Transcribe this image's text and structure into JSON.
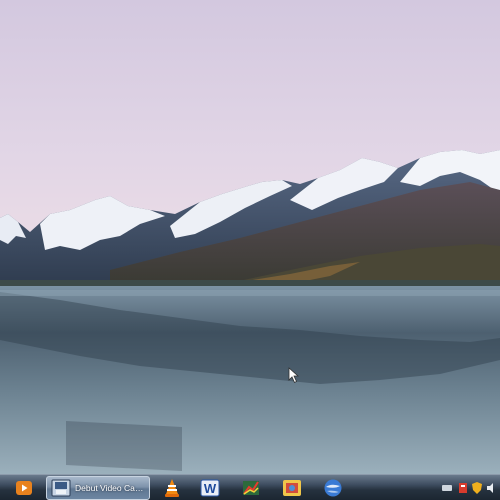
{
  "desktop": {
    "wallpaper": "lake-mountains-wallpaper"
  },
  "taskbar": {
    "start_icon": "media-player-icon",
    "active_task": {
      "icon": "video-capture-icon",
      "label": "Debut Video Capt..."
    },
    "pinned": [
      {
        "name": "vlc-icon"
      },
      {
        "name": "word-icon"
      },
      {
        "name": "graph-app-icon"
      },
      {
        "name": "photo-app-icon"
      },
      {
        "name": "google-earth-icon"
      }
    ],
    "tray": [
      {
        "name": "keyboard-tray-icon"
      },
      {
        "name": "security-tray-icon"
      },
      {
        "name": "shield-tray-icon"
      },
      {
        "name": "volume-tray-icon"
      }
    ]
  },
  "colors": {
    "sky_top": "#d7cde2",
    "sky_bottom": "#eadce8",
    "water": "#5f7382",
    "taskbar": "#2a3644",
    "active_task": "#7e93ab"
  }
}
